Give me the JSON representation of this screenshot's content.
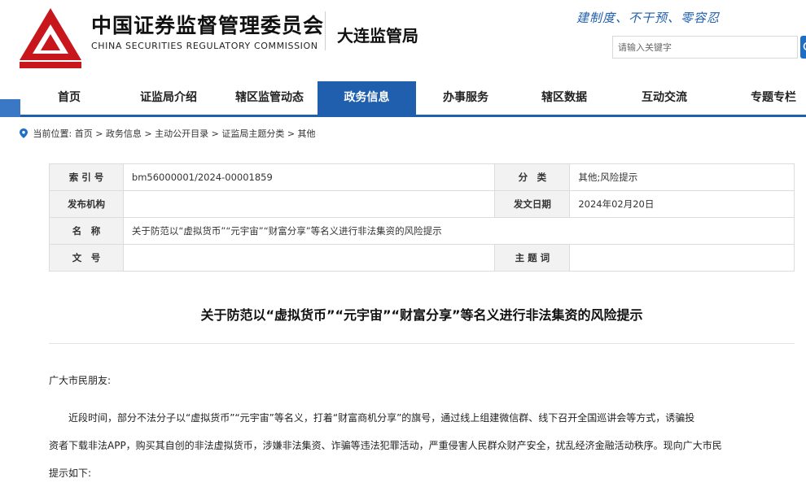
{
  "header": {
    "org_cn": "中国证券监督管理委员会",
    "org_en": "CHINA SECURITIES REGULATORY COMMISSION",
    "bureau": "大连监管局",
    "slogan": "建制度、不干预、零容忍",
    "search_placeholder": "请输入关键字",
    "logo_icon": "csrc-logo-icon",
    "search_icon": "search-icon",
    "brand_color": "#c8161d",
    "accent_color": "#1f5fae"
  },
  "nav": {
    "items": [
      {
        "label": "首页"
      },
      {
        "label": "证监局介绍"
      },
      {
        "label": "辖区监管动态"
      },
      {
        "label": "政务信息"
      },
      {
        "label": "办事服务"
      },
      {
        "label": "辖区数据"
      },
      {
        "label": "互动交流"
      },
      {
        "label": "专题专栏"
      }
    ],
    "active": "政务信息"
  },
  "breadcrumb": {
    "prefix": "当前位置:",
    "path": "首页 > 政务信息 > 主动公开目录 > 证监局主题分类 > 其他"
  },
  "meta": {
    "index_label": "索 引 号",
    "index_value": "bm56000001/2024-00001859",
    "category_label": "分　类",
    "category_value": "其他;风险提示",
    "issuer_label": "发布机构",
    "issuer_value": "",
    "date_label": "发文日期",
    "date_value": "2024年02月20日",
    "name_label": "名　称",
    "name_value": "关于防范以“虚拟货币”“元宇宙”“财富分享”等名义进行非法集资的风险提示",
    "docno_label": "文　号",
    "docno_value": "",
    "keywords_label": "主 题 词",
    "keywords_value": ""
  },
  "article": {
    "title": "关于防范以“虚拟货币”“元宇宙”“财富分享”等名义进行非法集资的风险提示",
    "greeting": "广大市民朋友:",
    "lines": [
      "　　近段时间，部分不法分子以“虚拟货币”“元宇宙”等名义，打着“财富商机分享”的旗号，通过线上组建微信群、线下召开全国巡讲会等方式，诱骗投",
      "资者下载非法APP，购买其自创的非法虚拟货币，涉嫌非法集资、诈骗等违法犯罪活动，严重侵害人民群众财产安全，扰乱经济金融活动秩序。现向广大市民",
      "提示如下:"
    ]
  }
}
